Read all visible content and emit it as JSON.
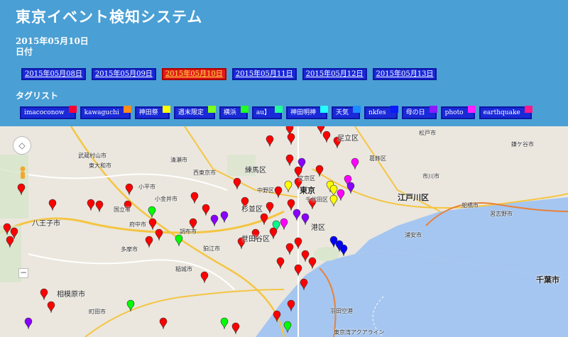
{
  "title": "東京イベント検知システム",
  "current_date": "2015年05月10日",
  "date_label": "日付",
  "dates": [
    {
      "label": "2015年05月08日",
      "active": false
    },
    {
      "label": "2015年05月09日",
      "active": false
    },
    {
      "label": "2015年05月10日",
      "active": true
    },
    {
      "label": "2015年05月11日",
      "active": false
    },
    {
      "label": "2015年05月12日",
      "active": false
    },
    {
      "label": "2015年05月13日",
      "active": false
    }
  ],
  "tag_heading": "タグリスト",
  "tags": [
    {
      "label": "imacoconow",
      "color": "#ff0033"
    },
    {
      "label": "kawaguchi",
      "color": "#ff8c1a"
    },
    {
      "label": "神田祭",
      "color": "#ffff00"
    },
    {
      "label": "週末限定",
      "color": "#7cff1a"
    },
    {
      "label": "横浜",
      "color": "#22ff22"
    },
    {
      "label": "au】",
      "color": "#22ff99"
    },
    {
      "label": "神田明神",
      "color": "#22ffff"
    },
    {
      "label": "天気",
      "color": "#1a8cff"
    },
    {
      "label": "nkfes",
      "color": "#0a1aff"
    },
    {
      "label": "母の日",
      "color": "#8c1aff"
    },
    {
      "label": "photo",
      "color": "#ff22ff"
    },
    {
      "label": "earthquake",
      "color": "#ff1a8c"
    }
  ],
  "map": {
    "labels": [
      {
        "text": "足立区",
        "size": "mid"
      },
      {
        "text": "江戸川区",
        "size": "big"
      },
      {
        "text": "練馬区",
        "size": "mid"
      },
      {
        "text": "東京",
        "size": "big"
      },
      {
        "text": "中野区",
        "size": "small"
      },
      {
        "text": "杉並区",
        "size": "mid"
      },
      {
        "text": "世田谷区",
        "size": "mid"
      },
      {
        "text": "港区",
        "size": "mid"
      },
      {
        "text": "八王子市",
        "size": "mid"
      },
      {
        "text": "相模原市",
        "size": "mid"
      },
      {
        "text": "千葉市",
        "size": "big"
      },
      {
        "text": "町田市",
        "size": "small"
      },
      {
        "text": "武蔵村山市",
        "size": "small"
      },
      {
        "text": "東大和市",
        "size": "small"
      },
      {
        "text": "小平市",
        "size": "small"
      },
      {
        "text": "小金井市",
        "size": "small"
      },
      {
        "text": "国立市",
        "size": "small"
      },
      {
        "text": "府中市",
        "size": "small"
      },
      {
        "text": "調布市",
        "size": "small"
      },
      {
        "text": "狛江市",
        "size": "small"
      },
      {
        "text": "多摩市",
        "size": "small"
      },
      {
        "text": "稲城市",
        "size": "small"
      },
      {
        "text": "清瀬市",
        "size": "small"
      },
      {
        "text": "西東京市",
        "size": "small"
      },
      {
        "text": "習志野市",
        "size": "small"
      },
      {
        "text": "浦安市",
        "size": "small"
      },
      {
        "text": "市川市",
        "size": "small"
      },
      {
        "text": "松戸市",
        "size": "small"
      },
      {
        "text": "鎌ケ谷市",
        "size": "small"
      },
      {
        "text": "船橋市",
        "size": "small"
      },
      {
        "text": "千代田区",
        "size": "small"
      },
      {
        "text": "文京区",
        "size": "small"
      },
      {
        "text": "葛飾区",
        "size": "small"
      },
      {
        "text": "羽田空港",
        "size": "small"
      },
      {
        "text": "東京湾アクアライン",
        "size": "small"
      }
    ]
  }
}
